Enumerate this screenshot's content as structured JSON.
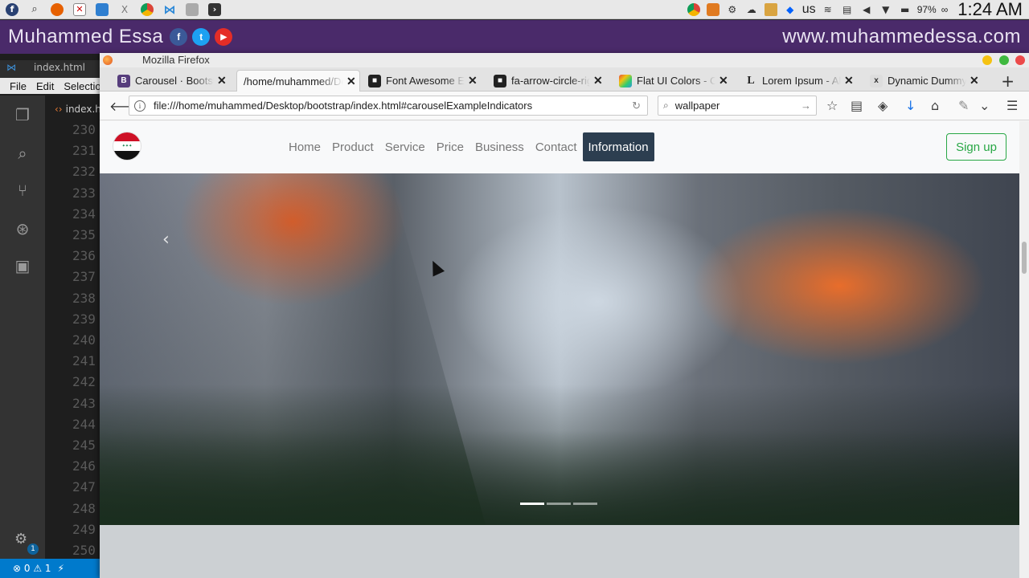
{
  "os": {
    "keyboard_layout": "us",
    "battery": "97%",
    "clock": "1:24 AM"
  },
  "banner": {
    "name": "Muhammed Essa",
    "url": "www.muhammedessa.com",
    "social": [
      "f",
      "t",
      "▶"
    ],
    "color": "#4a2a6a"
  },
  "editor": {
    "window_tab": "index.html",
    "menu": [
      "File",
      "Edit",
      "Selection"
    ],
    "file_tab": "index.html",
    "line_numbers": [
      "230",
      "231",
      "232",
      "233",
      "234",
      "235",
      "236",
      "237",
      "238",
      "239",
      "240",
      "241",
      "242",
      "243",
      "244",
      "245",
      "246",
      "247",
      "248",
      "249",
      "250"
    ],
    "status": {
      "errors": "0",
      "warnings": "1"
    },
    "badge": "1"
  },
  "browser": {
    "title": "Mozilla Firefox",
    "tabs": [
      {
        "label": "Carousel · Bootstrap",
        "fav": "B",
        "color": "#563d7c"
      },
      {
        "label": "/home/muhammed/Desktop",
        "fav": "",
        "color": ""
      },
      {
        "label": "Font Awesome Examples",
        "fav": "■",
        "color": "#222"
      },
      {
        "label": "fa-arrow-circle-right",
        "fav": "■",
        "color": "#222"
      },
      {
        "label": "Flat UI Colors - Co",
        "fav": "▦",
        "color": "#e74c3c"
      },
      {
        "label": "Lorem Ipsum - All",
        "fav": "L",
        "color": "#fff"
      },
      {
        "label": "Dynamic Dummy I",
        "fav": "x",
        "color": "#ddd"
      }
    ],
    "url": "file:///home/muhammed/Desktop/bootstrap/index.html#carouselExampleIndicators",
    "search": "wallpaper"
  },
  "site": {
    "menu": [
      "Home",
      "Product",
      "Service",
      "Price",
      "Business",
      "Contact",
      "Information"
    ],
    "active_menu": "Information",
    "signup": "Sign up",
    "carousel": {
      "indicator_count": 3,
      "active_index": 0,
      "prev_icon": "‹"
    },
    "accent": "#2c3e50",
    "signup_color": "#28a745"
  }
}
